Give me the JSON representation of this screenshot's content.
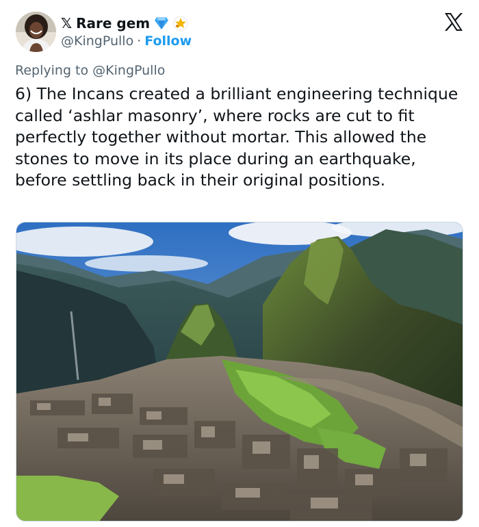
{
  "tweet": {
    "name_prefix": "𝕏",
    "display_name": "Rare gem",
    "badges": [
      "verified-diamond-icon",
      "star-badge-icon"
    ],
    "handle": "@KingPullo",
    "separator": "·",
    "follow_label": "Follow",
    "replying_prefix": "Replying to",
    "replying_handle": "@KingPullo",
    "text": "6) The Incans created a brilliant engineering technique called ‘ashlar masonry’, where rocks are cut to fit perfectly together without mortar. This allowed the stones to move in its place during an earthquake, before settling back in their original positions.",
    "media": {
      "kind": "photo",
      "subject": "machu-picchu-photo"
    }
  },
  "colors": {
    "text_primary": "#0f1419",
    "text_secondary": "#536471",
    "accent_blue": "#1d9bf0",
    "badge_blue": "#3ea9f5",
    "badge_gold": "#f4b400"
  },
  "icons": {
    "platform_logo": "x-logo-icon",
    "avatar": "avatar"
  }
}
